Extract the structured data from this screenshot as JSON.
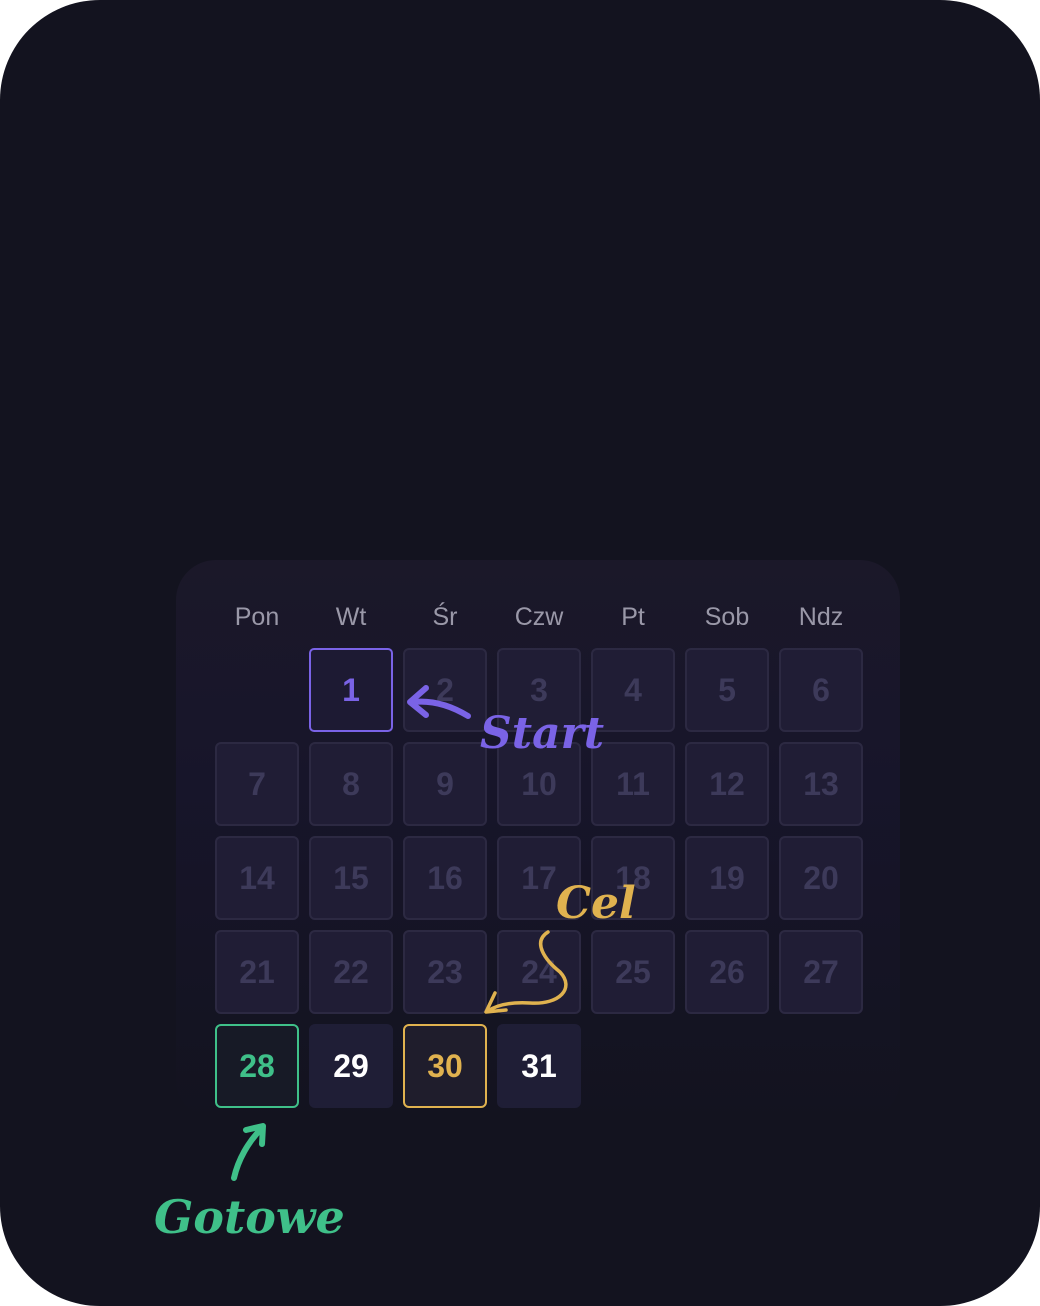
{
  "calendar": {
    "weekdays": [
      "Pon",
      "Wt",
      "Śr",
      "Czw",
      "Pt",
      "Sob",
      "Ndz"
    ],
    "days": [
      "1",
      "2",
      "3",
      "4",
      "5",
      "6",
      "7",
      "8",
      "9",
      "10",
      "11",
      "12",
      "13",
      "14",
      "15",
      "16",
      "17",
      "18",
      "19",
      "20",
      "21",
      "22",
      "23",
      "24",
      "25",
      "26",
      "27",
      "28",
      "29",
      "30",
      "31"
    ],
    "start_day": "1",
    "done_day": "28",
    "goal_day": "30"
  },
  "annotations": {
    "start": "Start",
    "goal": "Cel",
    "done": "Gotowe"
  },
  "colors": {
    "background": "#13131f",
    "start_accent": "#7a63e6",
    "goal_accent": "#e0b24f",
    "done_accent": "#3fc089",
    "inactive_text": "#3d3a5a",
    "active_text": "#ffffff"
  }
}
